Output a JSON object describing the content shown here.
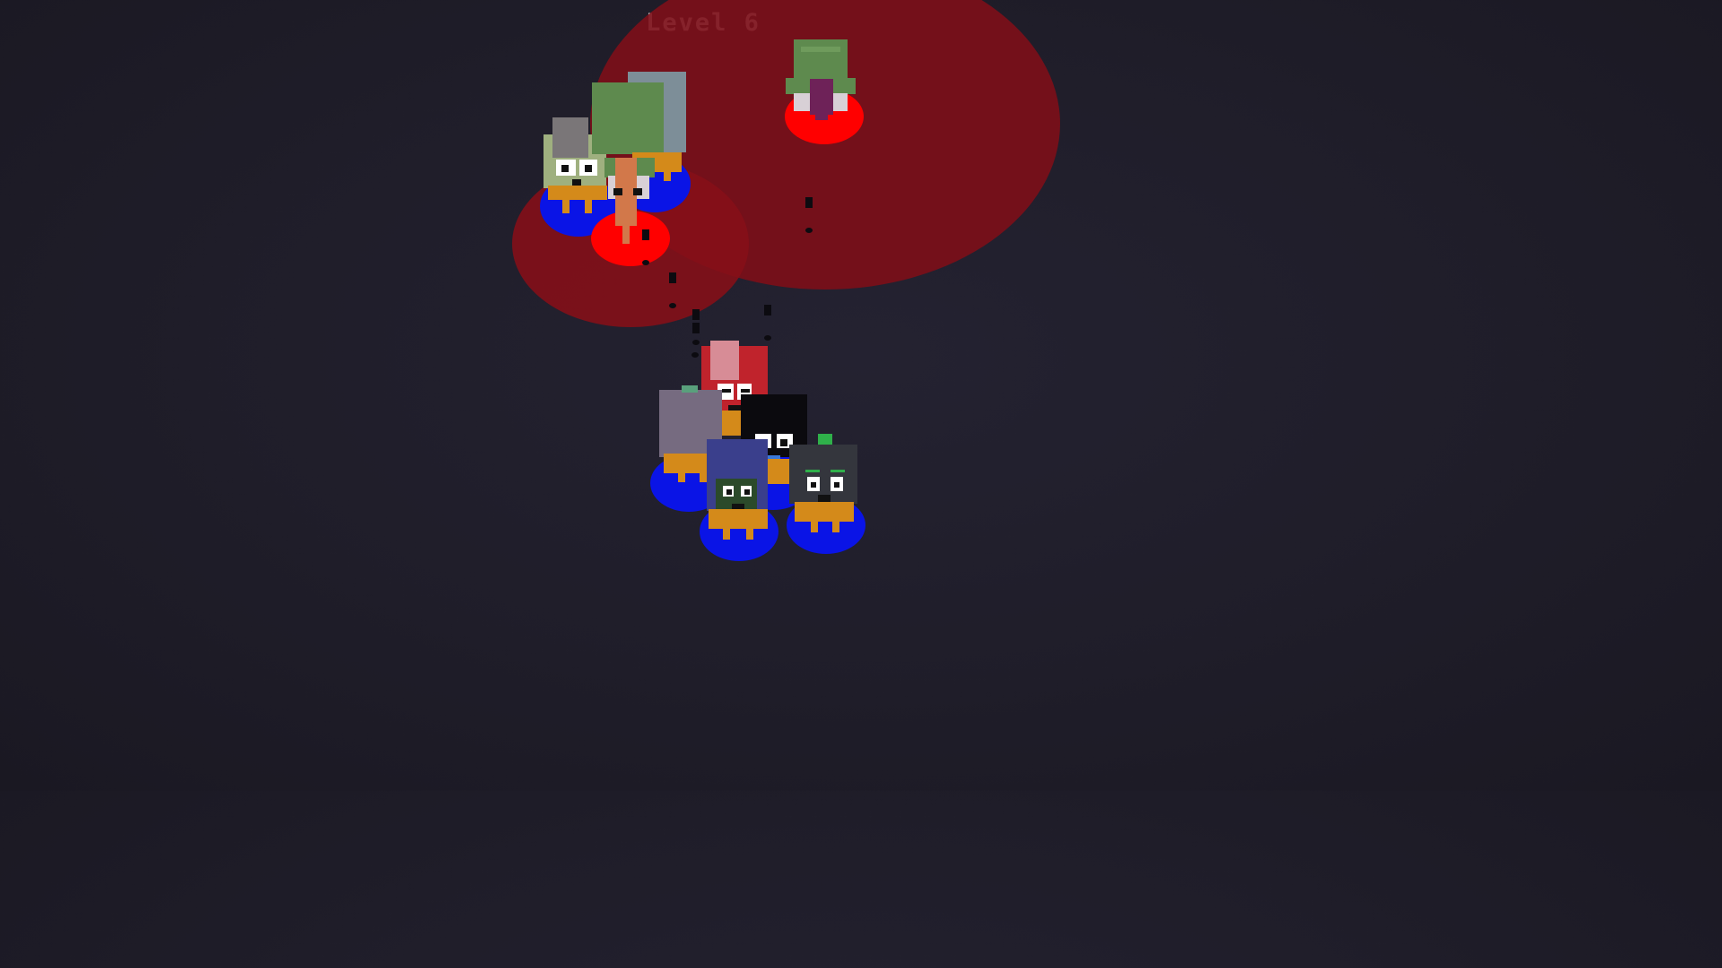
{
  "hud": {
    "level_label": "Level 6"
  },
  "colors": {
    "background": "#1f1d29",
    "enemy_range": "#8b0f17",
    "enemy_base": "#ff0000",
    "ally_base": "#0a14e6",
    "projectile": "#0c0b10",
    "body_orange": "#d48a1a"
  },
  "units": {
    "enemies": [
      "enemy-unit-eggplant",
      "enemy-unit-totem",
      "enemy-unit-cactus"
    ],
    "allies": [
      "ally-unit-grey-haired",
      "ally-unit-green-hood",
      "ally-unit-red",
      "ally-unit-lavender",
      "ally-unit-black-spiky",
      "ally-unit-blue-hood",
      "ally-unit-dark-sprout"
    ]
  }
}
